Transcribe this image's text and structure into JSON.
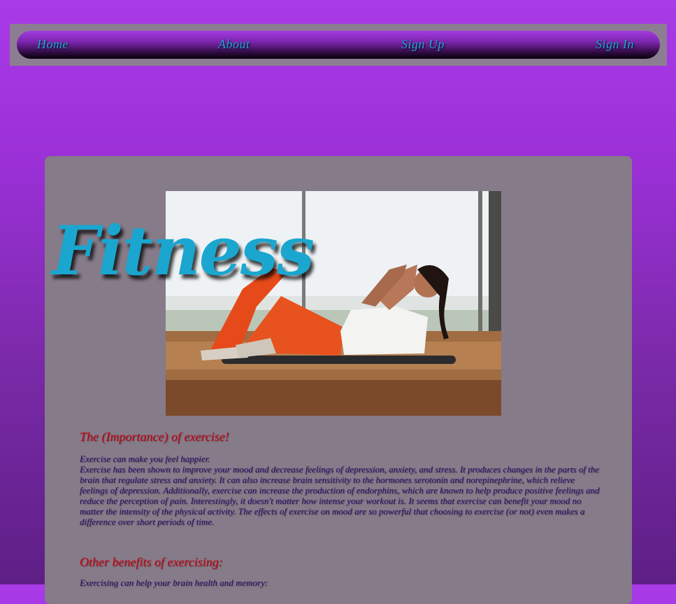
{
  "nav": {
    "home": "Home",
    "about": "About",
    "sign_up": "Sign Up",
    "sign_in": "Sign In"
  },
  "hero": {
    "title": "Fitness",
    "photo_icon": "woman-doing-crunches-photo"
  },
  "sections": {
    "importance": {
      "heading": "The (Importance) of exercise!",
      "intro": "Exercise can make you feel happier.",
      "paragraph": "Exercise has been shown to improve your mood and decrease feelings of depression, anxiety, and stress. It produces changes in the parts of the brain that regulate stress and anxiety. It can also increase brain sensitivity to the hormones serotonin and norepinephrine, which relieve feelings of depression. Additionally, exercise can increase the production of endorphins, which are known to help produce positive feelings and reduce the perception of pain. Interestingly, it doesn't matter how intense your workout is. It seems that exercise can benefit your mood no matter the intensity of the physical activity. The effects of exercise on mood are so powerful that choosing to exercise (or not) even makes a difference over short periods of time."
    },
    "benefits": {
      "heading": "Other benefits of exercising:",
      "first_item": "Exercising can help your brain health and memory:"
    }
  },
  "colors": {
    "nav_link": "#1ea5d6",
    "title": "#1aa6cf",
    "heading": "#c4000f",
    "body_text": "#2a0a6b",
    "card": "#867b88"
  }
}
